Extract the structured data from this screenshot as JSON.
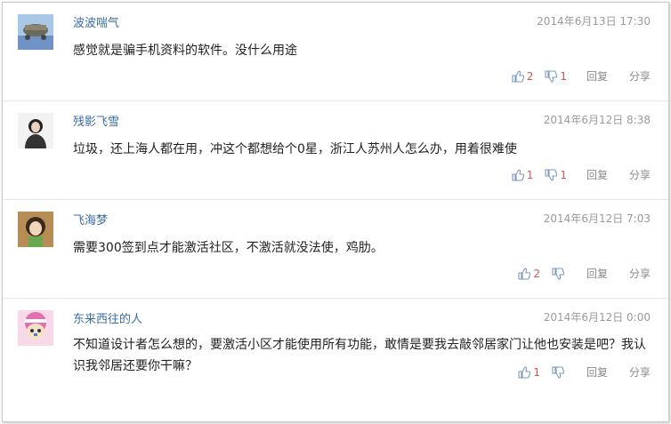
{
  "comments": [
    {
      "username": "波波喘气",
      "time": "2014年6月13日 17:30",
      "text": "感觉就是骗手机资料的软件。没什么用途",
      "likes": "2",
      "dislikes": "1",
      "reply": "回复",
      "share": "分享",
      "avatar_color": "#8fb4d9"
    },
    {
      "username": "残影飞雪",
      "time": "2014年6月12日 8:38",
      "text": "垃圾，还上海人都在用，冲这个都想给个0星，浙江人苏州人怎么办，用着很难使",
      "likes": "1",
      "dislikes": "1",
      "reply": "回复",
      "share": "分享",
      "avatar_color": "#d9d9d9"
    },
    {
      "username": "飞海梦",
      "time": "2014年6月12日 7:03",
      "text": "需要300签到点才能激活社区，不激活就没法使，鸡肋。",
      "likes": "2",
      "dislikes": "",
      "reply": "回复",
      "share": "分享",
      "avatar_color": "#c9a46a"
    },
    {
      "username": "东来西往的人",
      "time": "2014年6月12日 0:00",
      "text": "不知道设计者怎么想的，要激活小区才能使用所有功能，敢情是要我去敲邻居家门让他也安装是吧？我认识我邻居还要你干嘛？",
      "likes": "1",
      "dislikes": "",
      "reply": "回复",
      "share": "分享",
      "avatar_color": "#e6a0c8"
    }
  ],
  "colors": {
    "username": "#3b6da3",
    "count": "#d9534f",
    "meta": "#9a9a9a"
  }
}
